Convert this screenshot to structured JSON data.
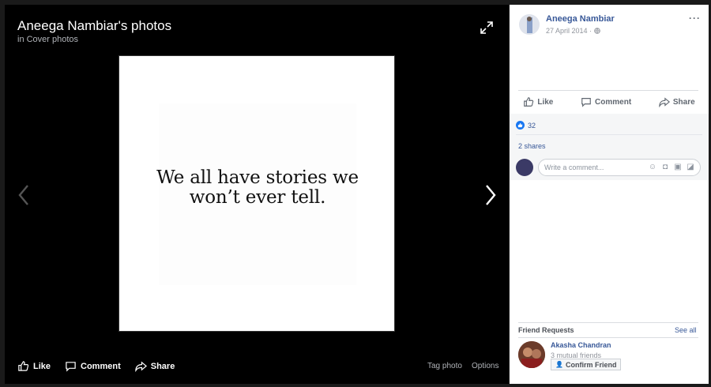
{
  "viewer": {
    "title": "Aneega Nambiar's photos",
    "subtitle": "in Cover photos",
    "quote_line1": "We all have stories we",
    "quote_line2": "won’t ever tell.",
    "actions": {
      "like": "Like",
      "comment": "Comment",
      "share": "Share"
    },
    "tag_photo": "Tag photo",
    "options": "Options"
  },
  "post": {
    "author": "Aneega Nambiar",
    "date": "27 April 2014 ·",
    "actions": {
      "like": "Like",
      "comment": "Comment",
      "share": "Share"
    },
    "like_count": "32",
    "shares": "2 shares",
    "comment_placeholder": "Write a comment..."
  },
  "friend_requests": {
    "title": "Friend Requests",
    "see_all": "See all",
    "items": [
      {
        "name": "Akasha Chandran",
        "mutual": "3 mutual friends",
        "button": "Confirm Friend"
      }
    ]
  },
  "colors": {
    "link": "#385898",
    "accent": "#1877f2",
    "stage_bg": "#000000"
  },
  "icons": [
    "expand-icon",
    "chevron-left-icon",
    "chevron-right-icon",
    "thumbs-up-icon",
    "comment-icon",
    "share-icon",
    "more-icon",
    "globe-icon",
    "like-reaction-icon",
    "emoji-icon",
    "camera-icon",
    "gif-icon",
    "sticker-icon",
    "add-friend-icon"
  ]
}
